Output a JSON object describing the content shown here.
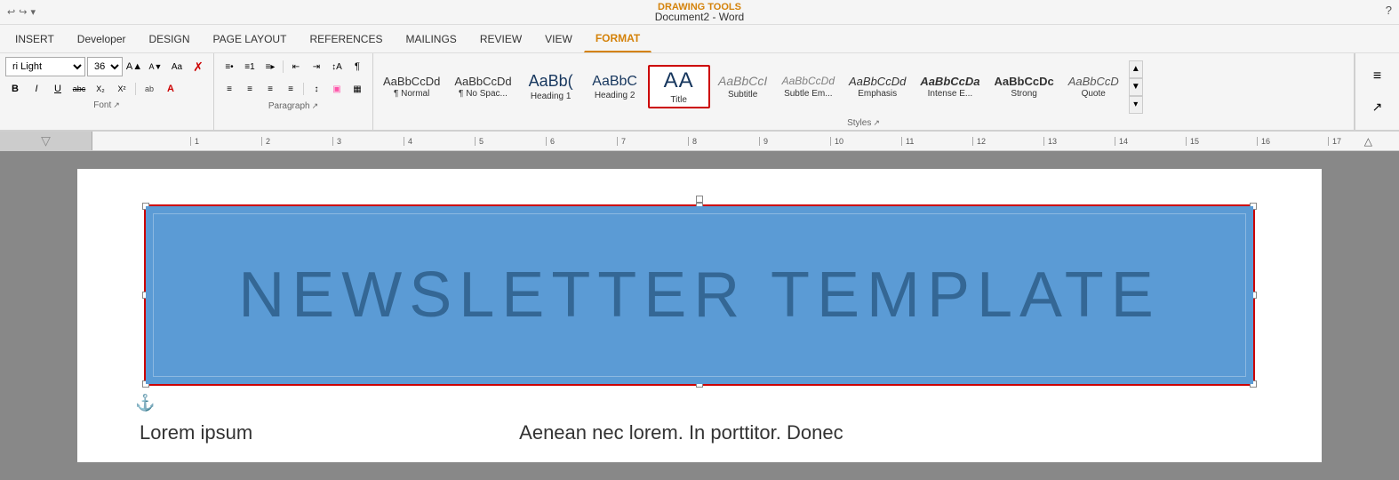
{
  "titleBar": {
    "title": "Document2 - Word",
    "drawingTools": "DRAWING TOOLS",
    "helpIcon": "?",
    "quickAccess": [
      "↩",
      "↪",
      "▾"
    ]
  },
  "tabs": [
    {
      "id": "insert",
      "label": "INSERT"
    },
    {
      "id": "developer",
      "label": "Developer"
    },
    {
      "id": "design",
      "label": "DESIGN"
    },
    {
      "id": "page-layout",
      "label": "PAGE LAYOUT"
    },
    {
      "id": "references",
      "label": "REFERENCES"
    },
    {
      "id": "mailings",
      "label": "MAILINGS"
    },
    {
      "id": "review",
      "label": "REVIEW"
    },
    {
      "id": "view",
      "label": "VIEW"
    },
    {
      "id": "format",
      "label": "FORMAT",
      "active": true
    }
  ],
  "font": {
    "name": "Calibri Light",
    "nameShort": "ri Light",
    "size": "36",
    "buttons": {
      "growLabel": "A",
      "shrinkLabel": "A",
      "caseLabel": "Aa",
      "clearLabel": "✗",
      "boldLabel": "B",
      "italicLabel": "I",
      "underlineLabel": "U",
      "strikeLabel": "abc",
      "subLabel": "X₂",
      "supLabel": "X²",
      "fontColorLabel": "A",
      "highlightLabel": "ab",
      "textColorLabel": "A"
    },
    "groupLabel": "Font"
  },
  "paragraph": {
    "groupLabel": "Paragraph"
  },
  "styles": {
    "groupLabel": "Styles",
    "items": [
      {
        "id": "normal",
        "preview": "AaBbCcDd",
        "label": "¶ Normal",
        "selected": false
      },
      {
        "id": "nospace",
        "preview": "AaBbCcDd",
        "label": "¶ No Spac...",
        "selected": false
      },
      {
        "id": "h1",
        "preview": "AaBb(",
        "label": "Heading 1",
        "selected": false
      },
      {
        "id": "h2",
        "preview": "AaBbC",
        "label": "Heading 2",
        "selected": false
      },
      {
        "id": "title",
        "preview": "AA",
        "label": "Title",
        "selected": true
      },
      {
        "id": "subtitle",
        "preview": "AaBbCcI",
        "label": "Subtitle",
        "selected": false
      },
      {
        "id": "subtle",
        "preview": "AaBbCcDd",
        "label": "Subtle Em...",
        "selected": false
      },
      {
        "id": "emphasis",
        "preview": "AaBbCcDd",
        "label": "Emphasis",
        "selected": false
      },
      {
        "id": "emphasis2",
        "preview": "AaBbCcDa",
        "label": "Intense E...",
        "selected": false
      },
      {
        "id": "strong",
        "preview": "AaBbCcDc",
        "label": "Strong",
        "selected": false
      },
      {
        "id": "quote",
        "preview": "AaBbCcD",
        "label": "Quote",
        "selected": false
      }
    ]
  },
  "ruler": {
    "marks": [
      "1",
      "2",
      "3",
      "4",
      "5",
      "6",
      "7",
      "8",
      "9",
      "10",
      "11",
      "12",
      "13",
      "14",
      "15",
      "16",
      "17"
    ]
  },
  "document": {
    "textBox": {
      "content": "NEWSLETTER TEMPLATE",
      "anchorIcon": "⚓"
    },
    "belowText": {
      "col1": "Lorem ipsum",
      "col2": "Aenean nec lorem. In porttitor. Donec"
    }
  }
}
